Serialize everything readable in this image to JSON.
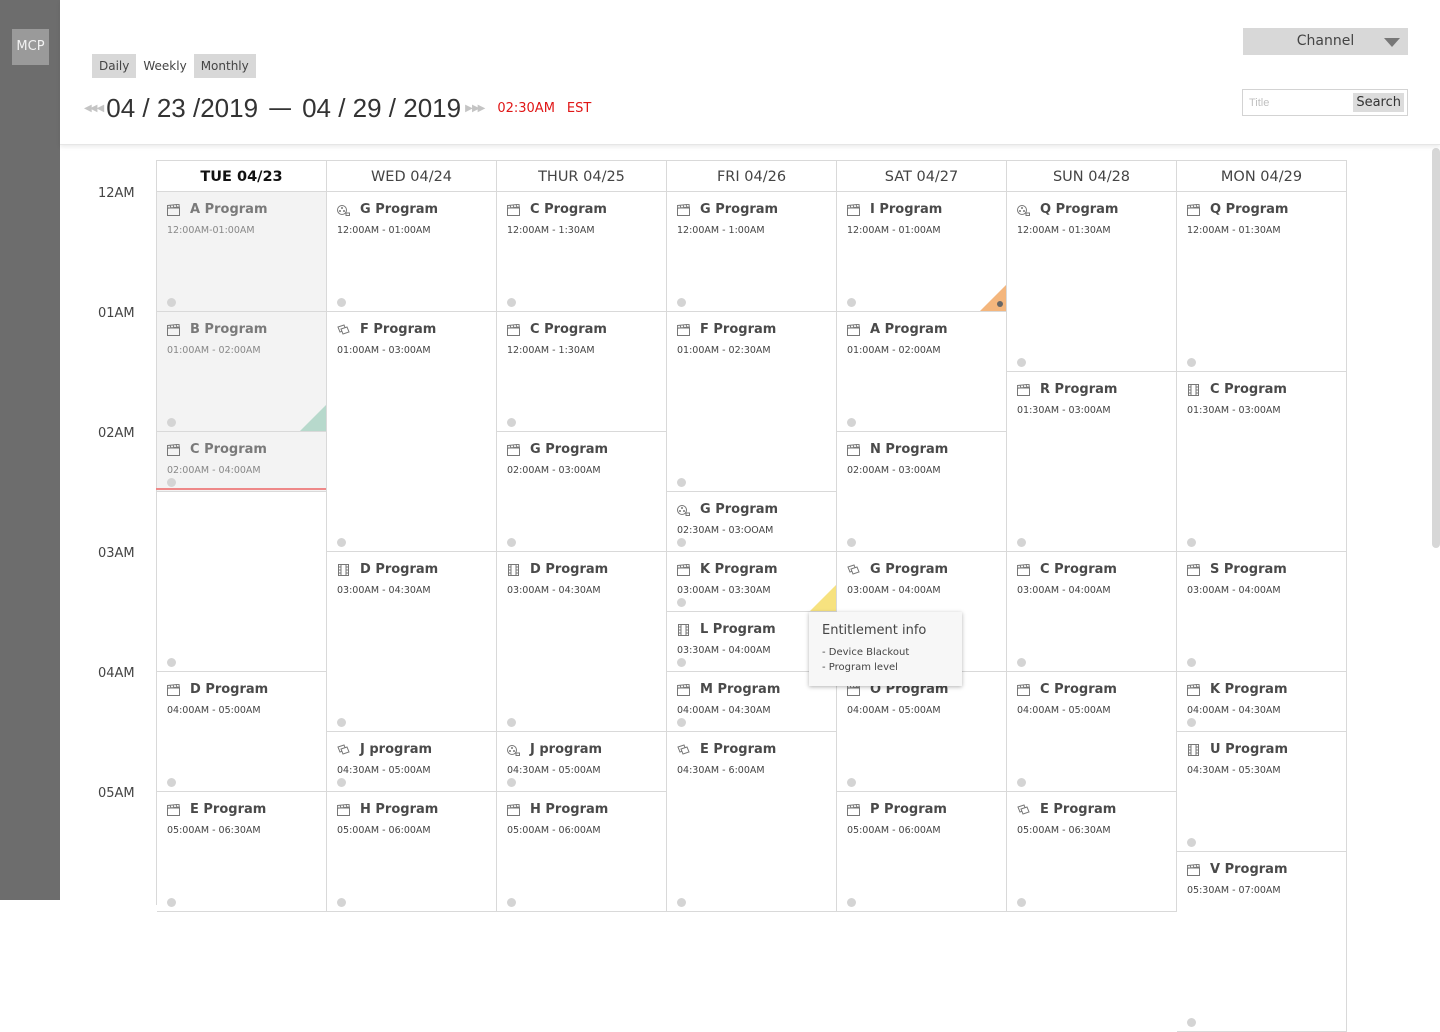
{
  "app": {
    "logo": "MCP"
  },
  "view_tabs": [
    {
      "label": "Daily",
      "active": false
    },
    {
      "label": "Weekly",
      "active": true
    },
    {
      "label": "Monthly",
      "active": false
    }
  ],
  "date_range": {
    "start": "04 / 23 /2019",
    "separator": "—",
    "end": "04 / 29 / 2019",
    "current_time": "02:30AM",
    "timezone": "EST"
  },
  "channel_select": {
    "label": "Channel"
  },
  "search": {
    "placeholder": "Title",
    "button": "Search"
  },
  "hours": [
    "12AM",
    "01AM",
    "02AM",
    "03AM",
    "04AM",
    "05AM"
  ],
  "days": [
    "TUE 04/23",
    "WED 04/24",
    "THUR 04/25",
    "FRI 04/26",
    "SAT 04/27",
    "SUN 04/28",
    "MON 04/29"
  ],
  "programs": [
    {
      "day": 0,
      "start": 0,
      "dur": 1,
      "title": "A Program",
      "time": "12:00AM-01:00AM",
      "icon": "clapper-icon",
      "past": true
    },
    {
      "day": 0,
      "start": 1,
      "dur": 1,
      "title": "B  Program",
      "time": "01:00AM - 02:00AM",
      "icon": "clapper-icon",
      "past": true,
      "flag": "green"
    },
    {
      "day": 0,
      "start": 2,
      "dur": 0.5,
      "title": "C Program",
      "time": "02:00AM - 04:00AM",
      "icon": "clapper-icon",
      "past": true
    },
    {
      "day": 0,
      "start": 2.5,
      "dur": 1.5,
      "title": "",
      "time": "",
      "icon": "",
      "past": false
    },
    {
      "day": 0,
      "start": 4,
      "dur": 1,
      "title": "D Program",
      "time": "04:00AM - 05:00AM",
      "icon": "clapper-icon"
    },
    {
      "day": 0,
      "start": 5,
      "dur": 1,
      "title": "E Program",
      "time": "05:00AM - 06:30AM",
      "icon": "clapper-icon"
    },
    {
      "day": 1,
      "start": 0,
      "dur": 1,
      "title": "G Program",
      "time": "12:00AM - 01:00AM",
      "icon": "film-reel-icon"
    },
    {
      "day": 1,
      "start": 1,
      "dur": 2,
      "title": "F Program",
      "time": "01:00AM - 03:00AM",
      "icon": "tickets-icon"
    },
    {
      "day": 1,
      "start": 3,
      "dur": 1.5,
      "title": "D Program",
      "time": "03:00AM - 04:30AM",
      "icon": "film-strip-icon"
    },
    {
      "day": 1,
      "start": 4.5,
      "dur": 0.5,
      "title": "J program",
      "time": "04:30AM - 05:00AM",
      "icon": "tickets-icon"
    },
    {
      "day": 1,
      "start": 5,
      "dur": 1,
      "title": "H Program",
      "time": "05:00AM - 06:00AM",
      "icon": "clapper-icon"
    },
    {
      "day": 2,
      "start": 0,
      "dur": 1,
      "title": "C Program",
      "time": "12:00AM - 1:30AM",
      "icon": "clapper-icon"
    },
    {
      "day": 2,
      "start": 1,
      "dur": 1,
      "title": "C Program",
      "time": "12:00AM - 1:30AM",
      "icon": "clapper-icon"
    },
    {
      "day": 2,
      "start": 2,
      "dur": 1,
      "title": "G Program",
      "time": "02:00AM - 03:00AM",
      "icon": "clapper-icon"
    },
    {
      "day": 2,
      "start": 3,
      "dur": 1.5,
      "title": "D Program",
      "time": "03:00AM - 04:30AM",
      "icon": "film-strip-icon"
    },
    {
      "day": 2,
      "start": 4.5,
      "dur": 0.5,
      "title": "J program",
      "time": "04:30AM - 05:00AM",
      "icon": "film-reel-icon"
    },
    {
      "day": 2,
      "start": 5,
      "dur": 1,
      "title": "H Program",
      "time": "05:00AM - 06:00AM",
      "icon": "clapper-icon"
    },
    {
      "day": 3,
      "start": 0,
      "dur": 1,
      "title": "G Program",
      "time": "12:00AM - 1:00AM",
      "icon": "clapper-icon"
    },
    {
      "day": 3,
      "start": 1,
      "dur": 1.5,
      "title": "F Program",
      "time": "01:00AM - 02:30AM",
      "icon": "clapper-icon"
    },
    {
      "day": 3,
      "start": 2.5,
      "dur": 0.5,
      "title": "G Program",
      "time": "02:30AM - 03:OOAM",
      "icon": "film-reel-icon"
    },
    {
      "day": 3,
      "start": 3,
      "dur": 0.5,
      "title": "K Program",
      "time": "03:00AM - 03:30AM",
      "icon": "clapper-icon",
      "flag": "yellow"
    },
    {
      "day": 3,
      "start": 3.5,
      "dur": 0.5,
      "title": "L Program",
      "time": "03:30AM - 04:00AM",
      "icon": "film-strip-icon"
    },
    {
      "day": 3,
      "start": 4,
      "dur": 0.5,
      "title": "M Program",
      "time": "04:00AM - 04:30AM",
      "icon": "clapper-icon"
    },
    {
      "day": 3,
      "start": 4.5,
      "dur": 1.5,
      "title": "E Program",
      "time": "04:30AM - 6:00AM",
      "icon": "tickets-icon"
    },
    {
      "day": 4,
      "start": 0,
      "dur": 1,
      "title": "I Program",
      "time": "12:00AM - 01:00AM",
      "icon": "clapper-icon",
      "flag": "orange"
    },
    {
      "day": 4,
      "start": 1,
      "dur": 1,
      "title": "A Program",
      "time": "01:00AM - 02:00AM",
      "icon": "clapper-icon"
    },
    {
      "day": 4,
      "start": 2,
      "dur": 1,
      "title": "N Program",
      "time": "02:00AM - 03:00AM",
      "icon": "clapper-icon"
    },
    {
      "day": 4,
      "start": 3,
      "dur": 1,
      "title": "G Program",
      "time": "03:00AM - 04:00AM",
      "icon": "tickets-icon"
    },
    {
      "day": 4,
      "start": 4,
      "dur": 1,
      "title": "O Program",
      "time": "04:00AM - 05:00AM",
      "icon": "clapper-icon"
    },
    {
      "day": 4,
      "start": 5,
      "dur": 1,
      "title": "P Program",
      "time": "05:00AM - 06:00AM",
      "icon": "clapper-icon"
    },
    {
      "day": 5,
      "start": 0,
      "dur": 1.5,
      "title": "Q Program",
      "time": "12:00AM - 01:30AM",
      "icon": "film-reel-icon"
    },
    {
      "day": 5,
      "start": 1.5,
      "dur": 1.5,
      "title": "R  Program",
      "time": "01:30AM - 03:00AM",
      "icon": "clapper-icon"
    },
    {
      "day": 5,
      "start": 3,
      "dur": 1,
      "title": "C Program",
      "time": "03:00AM - 04:00AM",
      "icon": "clapper-icon"
    },
    {
      "day": 5,
      "start": 4,
      "dur": 1,
      "title": "C Program",
      "time": "04:00AM - 05:00AM",
      "icon": "clapper-icon"
    },
    {
      "day": 5,
      "start": 5,
      "dur": 1,
      "title": "E Program",
      "time": "05:00AM - 06:30AM",
      "icon": "tickets-icon"
    },
    {
      "day": 6,
      "start": 0,
      "dur": 1.5,
      "title": "Q Program",
      "time": "12:00AM - 01:30AM",
      "icon": "clapper-icon"
    },
    {
      "day": 6,
      "start": 1.5,
      "dur": 1.5,
      "title": "C Program",
      "time": "01:30AM - 03:00AM",
      "icon": "film-strip-icon"
    },
    {
      "day": 6,
      "start": 3,
      "dur": 1,
      "title": "S Program",
      "time": "03:00AM - 04:00AM",
      "icon": "clapper-icon"
    },
    {
      "day": 6,
      "start": 4,
      "dur": 0.5,
      "title": "K Program",
      "time": "04:00AM - 04:30AM",
      "icon": "clapper-icon"
    },
    {
      "day": 6,
      "start": 4.5,
      "dur": 1,
      "title": "U Program",
      "time": "04:30AM - 05:30AM",
      "icon": "film-strip-icon"
    },
    {
      "day": 6,
      "start": 5.5,
      "dur": 1.5,
      "title": "V Program",
      "time": "05:30AM - 07:00AM",
      "icon": "clapper-icon"
    }
  ],
  "tooltip": {
    "title": "Entitlement info",
    "items": [
      "- Device Blackout",
      "- Program level"
    ]
  },
  "colors": {
    "accent_red": "#e01616",
    "flag_orange": "#f4b67d",
    "flag_green": "#b7d9cc",
    "flag_yellow": "#f7e27f"
  }
}
